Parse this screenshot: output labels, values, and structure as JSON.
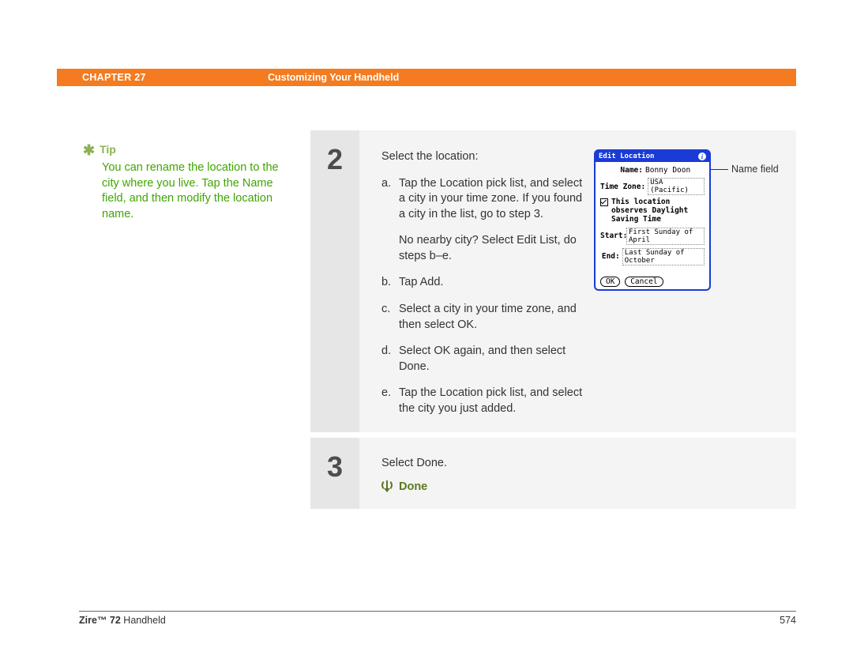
{
  "header": {
    "chapter": "CHAPTER 27",
    "title": "Customizing Your Handheld"
  },
  "tip": {
    "label": "Tip",
    "text": "You can rename the location to the city where you live. Tap the Name field, and then modify the location name."
  },
  "step2": {
    "number": "2",
    "intro": "Select the location:",
    "items": {
      "a": {
        "marker": "a.",
        "text": "Tap the Location pick list, and select a city in your time zone. If you found a city in the list, go to step 3."
      },
      "noCity": "No nearby city? Select Edit List, do steps b–e.",
      "b": {
        "marker": "b.",
        "text": "Tap Add."
      },
      "c": {
        "marker": "c.",
        "text": "Select a city in your time zone, and then select OK."
      },
      "d": {
        "marker": "d.",
        "text": "Select OK again, and then select Done."
      },
      "e": {
        "marker": "e.",
        "text": "Tap the Location pick list, and select the city you just added."
      }
    }
  },
  "step3": {
    "number": "3",
    "text": "Select Done.",
    "done": "Done"
  },
  "dialog": {
    "title": "Edit Location",
    "nameLabel": "Name:",
    "nameValue": "Bonny Doon",
    "tzLabel": "Time Zone:",
    "tzValue": "USA (Pacific)",
    "dstLabel": "This location observes Daylight Saving Time",
    "startLabel": "Start:",
    "startValue": "First Sunday of April",
    "endLabel": "End:",
    "endValue": "Last Sunday of October",
    "ok": "OK",
    "cancel": "Cancel",
    "callout": "Name field"
  },
  "footer": {
    "productBold": "Zire™ 72",
    "productRest": " Handheld",
    "page": "574"
  }
}
